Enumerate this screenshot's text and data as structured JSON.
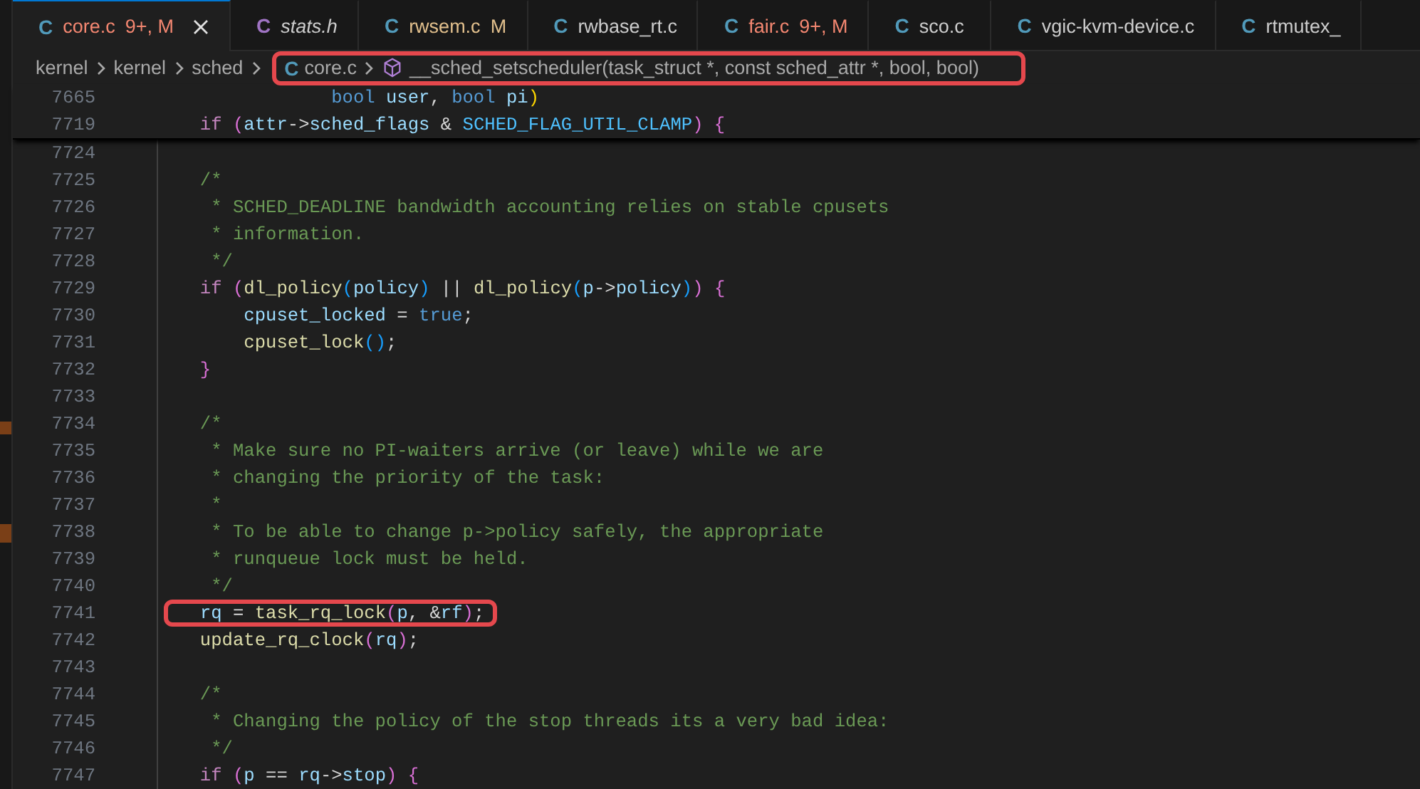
{
  "tabs": [
    {
      "icon": "C",
      "color": "#519aba",
      "label": "core.c",
      "decoration": "9+, M",
      "kind": "error",
      "preview": false,
      "selected": true
    },
    {
      "icon": "C",
      "color": "#a074c4",
      "label": "stats.h",
      "kind": "plain",
      "preview": true,
      "selected": false
    },
    {
      "icon": "C",
      "color": "#519aba",
      "label": "rwsem.c",
      "decoration": "M",
      "kind": "modified",
      "preview": false,
      "selected": false
    },
    {
      "icon": "C",
      "color": "#519aba",
      "label": "rwbase_rt.c",
      "kind": "plain",
      "preview": false,
      "selected": false
    },
    {
      "icon": "C",
      "color": "#519aba",
      "label": "fair.c",
      "decoration": "9+, M",
      "kind": "error",
      "preview": false,
      "selected": false
    },
    {
      "icon": "C",
      "color": "#519aba",
      "label": "sco.c",
      "kind": "plain",
      "preview": false,
      "selected": false
    },
    {
      "icon": "C",
      "color": "#519aba",
      "label": "vgic-kvm-device.c",
      "kind": "plain",
      "preview": false,
      "selected": false
    },
    {
      "icon": "C",
      "color": "#519aba",
      "label": "rtmutex_",
      "kind": "plain",
      "preview": false,
      "selected": false
    }
  ],
  "breadcrumbs": [
    {
      "kind": "folder",
      "label": "kernel",
      "highlighted": false
    },
    {
      "kind": "folder",
      "label": "kernel",
      "highlighted": false
    },
    {
      "kind": "folder",
      "label": "sched",
      "highlighted": false
    },
    {
      "kind": "file",
      "icon": "C",
      "label": "core.c",
      "highlighted": true
    },
    {
      "kind": "symbol",
      "label": "__sched_setscheduler(task_struct *, const sched_attr *, bool, bool)",
      "highlighted": true
    }
  ],
  "sticky_lines": [
    {
      "number": "7665",
      "highlighted": false,
      "tokens": [
        {
          "kind": "type",
          "text": "                    bool "
        },
        {
          "kind": "var",
          "text": "user"
        },
        {
          "kind": "plain",
          "text": ", "
        },
        {
          "kind": "type",
          "text": "bool "
        },
        {
          "kind": "var",
          "text": "pi"
        },
        {
          "kind": "b1",
          "text": ")"
        }
      ]
    },
    {
      "number": "7719",
      "highlighted": false,
      "tokens": [
        {
          "kind": "keyword",
          "text": "        if "
        },
        {
          "kind": "b2",
          "text": "("
        },
        {
          "kind": "var",
          "text": "attr"
        },
        {
          "kind": "plain",
          "text": "->"
        },
        {
          "kind": "var",
          "text": "sched_flags"
        },
        {
          "kind": "plain",
          "text": " & "
        },
        {
          "kind": "const",
          "text": "SCHED_FLAG_UTIL_CLAMP"
        },
        {
          "kind": "b2",
          "text": ") {"
        }
      ]
    }
  ],
  "lines": [
    {
      "number": "7724",
      "highlighted": false
    },
    {
      "number": "7725",
      "highlighted": false,
      "tokens": [
        {
          "kind": "comment",
          "text": "        /*"
        }
      ]
    },
    {
      "number": "7726",
      "highlighted": false,
      "tokens": [
        {
          "kind": "comment",
          "text": "         * SCHED_DEADLINE bandwidth accounting relies on stable cpusets"
        }
      ]
    },
    {
      "number": "7727",
      "highlighted": false,
      "tokens": [
        {
          "kind": "comment",
          "text": "         * information."
        }
      ]
    },
    {
      "number": "7728",
      "highlighted": false,
      "tokens": [
        {
          "kind": "comment",
          "text": "         */"
        }
      ]
    },
    {
      "number": "7729",
      "highlighted": false,
      "tokens": [
        {
          "kind": "keyword",
          "text": "        if "
        },
        {
          "kind": "b2",
          "text": "("
        },
        {
          "kind": "func",
          "text": "dl_policy"
        },
        {
          "kind": "b3",
          "text": "("
        },
        {
          "kind": "var",
          "text": "policy"
        },
        {
          "kind": "b3",
          "text": ")"
        },
        {
          "kind": "plain",
          "text": " || "
        },
        {
          "kind": "func",
          "text": "dl_policy"
        },
        {
          "kind": "b3",
          "text": "("
        },
        {
          "kind": "var",
          "text": "p"
        },
        {
          "kind": "plain",
          "text": "->"
        },
        {
          "kind": "var",
          "text": "policy"
        },
        {
          "kind": "b3",
          "text": ")"
        },
        {
          "kind": "b2",
          "text": ") {"
        }
      ]
    },
    {
      "number": "7730",
      "highlighted": false,
      "tokens": [
        {
          "kind": "var",
          "text": "            cpuset_locked"
        },
        {
          "kind": "plain",
          "text": " = "
        },
        {
          "kind": "type",
          "text": "true"
        },
        {
          "kind": "plain",
          "text": ";"
        }
      ]
    },
    {
      "number": "7731",
      "highlighted": false,
      "tokens": [
        {
          "kind": "func",
          "text": "            cpuset_lock"
        },
        {
          "kind": "b3",
          "text": "()"
        },
        {
          "kind": "plain",
          "text": ";"
        }
      ]
    },
    {
      "number": "7732",
      "highlighted": false,
      "tokens": [
        {
          "kind": "b2",
          "text": "        }"
        }
      ]
    },
    {
      "number": "7733",
      "highlighted": false
    },
    {
      "number": "7734",
      "highlighted": false,
      "tokens": [
        {
          "kind": "comment",
          "text": "        /*"
        }
      ]
    },
    {
      "number": "7735",
      "highlighted": false,
      "tokens": [
        {
          "kind": "comment",
          "text": "         * Make sure no PI-waiters arrive (or leave) while we are"
        }
      ]
    },
    {
      "number": "7736",
      "highlighted": false,
      "tokens": [
        {
          "kind": "comment",
          "text": "         * changing the priority of the task:"
        }
      ]
    },
    {
      "number": "7737",
      "highlighted": false,
      "tokens": [
        {
          "kind": "comment",
          "text": "         *"
        }
      ]
    },
    {
      "number": "7738",
      "highlighted": false,
      "tokens": [
        {
          "kind": "comment",
          "text": "         * To be able to change p->policy safely, the appropriate"
        }
      ]
    },
    {
      "number": "7739",
      "highlighted": false,
      "tokens": [
        {
          "kind": "comment",
          "text": "         * runqueue lock must be held."
        }
      ]
    },
    {
      "number": "7740",
      "highlighted": false,
      "tokens": [
        {
          "kind": "comment",
          "text": "         */"
        }
      ]
    },
    {
      "number": "7741",
      "highlighted": true,
      "tokens": [
        {
          "kind": "var",
          "text": "        rq"
        },
        {
          "kind": "plain",
          "text": " = "
        },
        {
          "kind": "func",
          "text": "task_rq_lock"
        },
        {
          "kind": "b2",
          "text": "("
        },
        {
          "kind": "var",
          "text": "p"
        },
        {
          "kind": "plain",
          "text": ", &"
        },
        {
          "kind": "var",
          "text": "rf"
        },
        {
          "kind": "b2",
          "text": ")"
        },
        {
          "kind": "plain",
          "text": ";"
        }
      ]
    },
    {
      "number": "7742",
      "highlighted": false,
      "tokens": [
        {
          "kind": "func",
          "text": "        update_rq_clock"
        },
        {
          "kind": "b2",
          "text": "("
        },
        {
          "kind": "var",
          "text": "rq"
        },
        {
          "kind": "b2",
          "text": ")"
        },
        {
          "kind": "plain",
          "text": ";"
        }
      ]
    },
    {
      "number": "7743",
      "highlighted": false
    },
    {
      "number": "7744",
      "highlighted": false,
      "tokens": [
        {
          "kind": "comment",
          "text": "        /*"
        }
      ]
    },
    {
      "number": "7745",
      "highlighted": false,
      "tokens": [
        {
          "kind": "comment",
          "text": "         * Changing the policy of the stop threads its a very bad idea:"
        }
      ]
    },
    {
      "number": "7746",
      "highlighted": false,
      "tokens": [
        {
          "kind": "comment",
          "text": "         */"
        }
      ]
    },
    {
      "number": "7747",
      "highlighted": false,
      "tokens": [
        {
          "kind": "keyword",
          "text": "        if "
        },
        {
          "kind": "b2",
          "text": "("
        },
        {
          "kind": "var",
          "text": "p"
        },
        {
          "kind": "plain",
          "text": " == "
        },
        {
          "kind": "var",
          "text": "rq"
        },
        {
          "kind": "plain",
          "text": "->"
        },
        {
          "kind": "var",
          "text": "stop"
        },
        {
          "kind": "b2",
          "text": ") {"
        }
      ]
    }
  ]
}
